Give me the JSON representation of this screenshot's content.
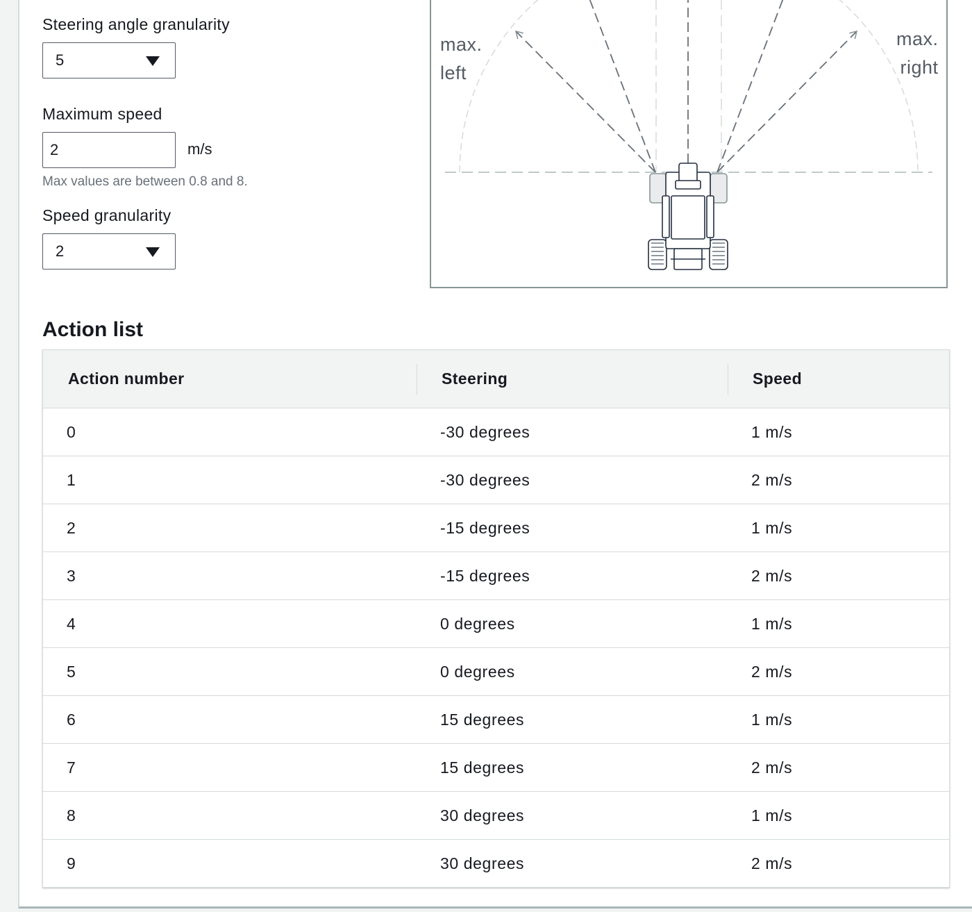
{
  "form": {
    "steering_granularity": {
      "label": "Steering angle granularity",
      "value": "5"
    },
    "max_speed": {
      "label": "Maximum speed",
      "value": "2",
      "unit": "m/s",
      "hint": "Max values are between 0.8 and 8."
    },
    "speed_granularity": {
      "label": "Speed granularity",
      "value": "2"
    }
  },
  "diagram": {
    "left_label_line1": "max.",
    "left_label_line2": "left",
    "right_label_line1": "max.",
    "right_label_line2": "right",
    "icon": "vehicle-top-view-icon",
    "line_color": "#879596"
  },
  "action_list": {
    "title": "Action list",
    "columns": [
      "Action number",
      "Steering",
      "Speed"
    ],
    "rows": [
      {
        "number": "0",
        "steering": "-30 degrees",
        "speed": "1 m/s"
      },
      {
        "number": "1",
        "steering": "-30 degrees",
        "speed": "2 m/s"
      },
      {
        "number": "2",
        "steering": "-15 degrees",
        "speed": "1 m/s"
      },
      {
        "number": "3",
        "steering": "-15 degrees",
        "speed": "2 m/s"
      },
      {
        "number": "4",
        "steering": "0 degrees",
        "speed": "1 m/s"
      },
      {
        "number": "5",
        "steering": "0 degrees",
        "speed": "2 m/s"
      },
      {
        "number": "6",
        "steering": "15 degrees",
        "speed": "1 m/s"
      },
      {
        "number": "7",
        "steering": "15 degrees",
        "speed": "2 m/s"
      },
      {
        "number": "8",
        "steering": "30 degrees",
        "speed": "1 m/s"
      },
      {
        "number": "9",
        "steering": "30 degrees",
        "speed": "2 m/s"
      }
    ]
  }
}
